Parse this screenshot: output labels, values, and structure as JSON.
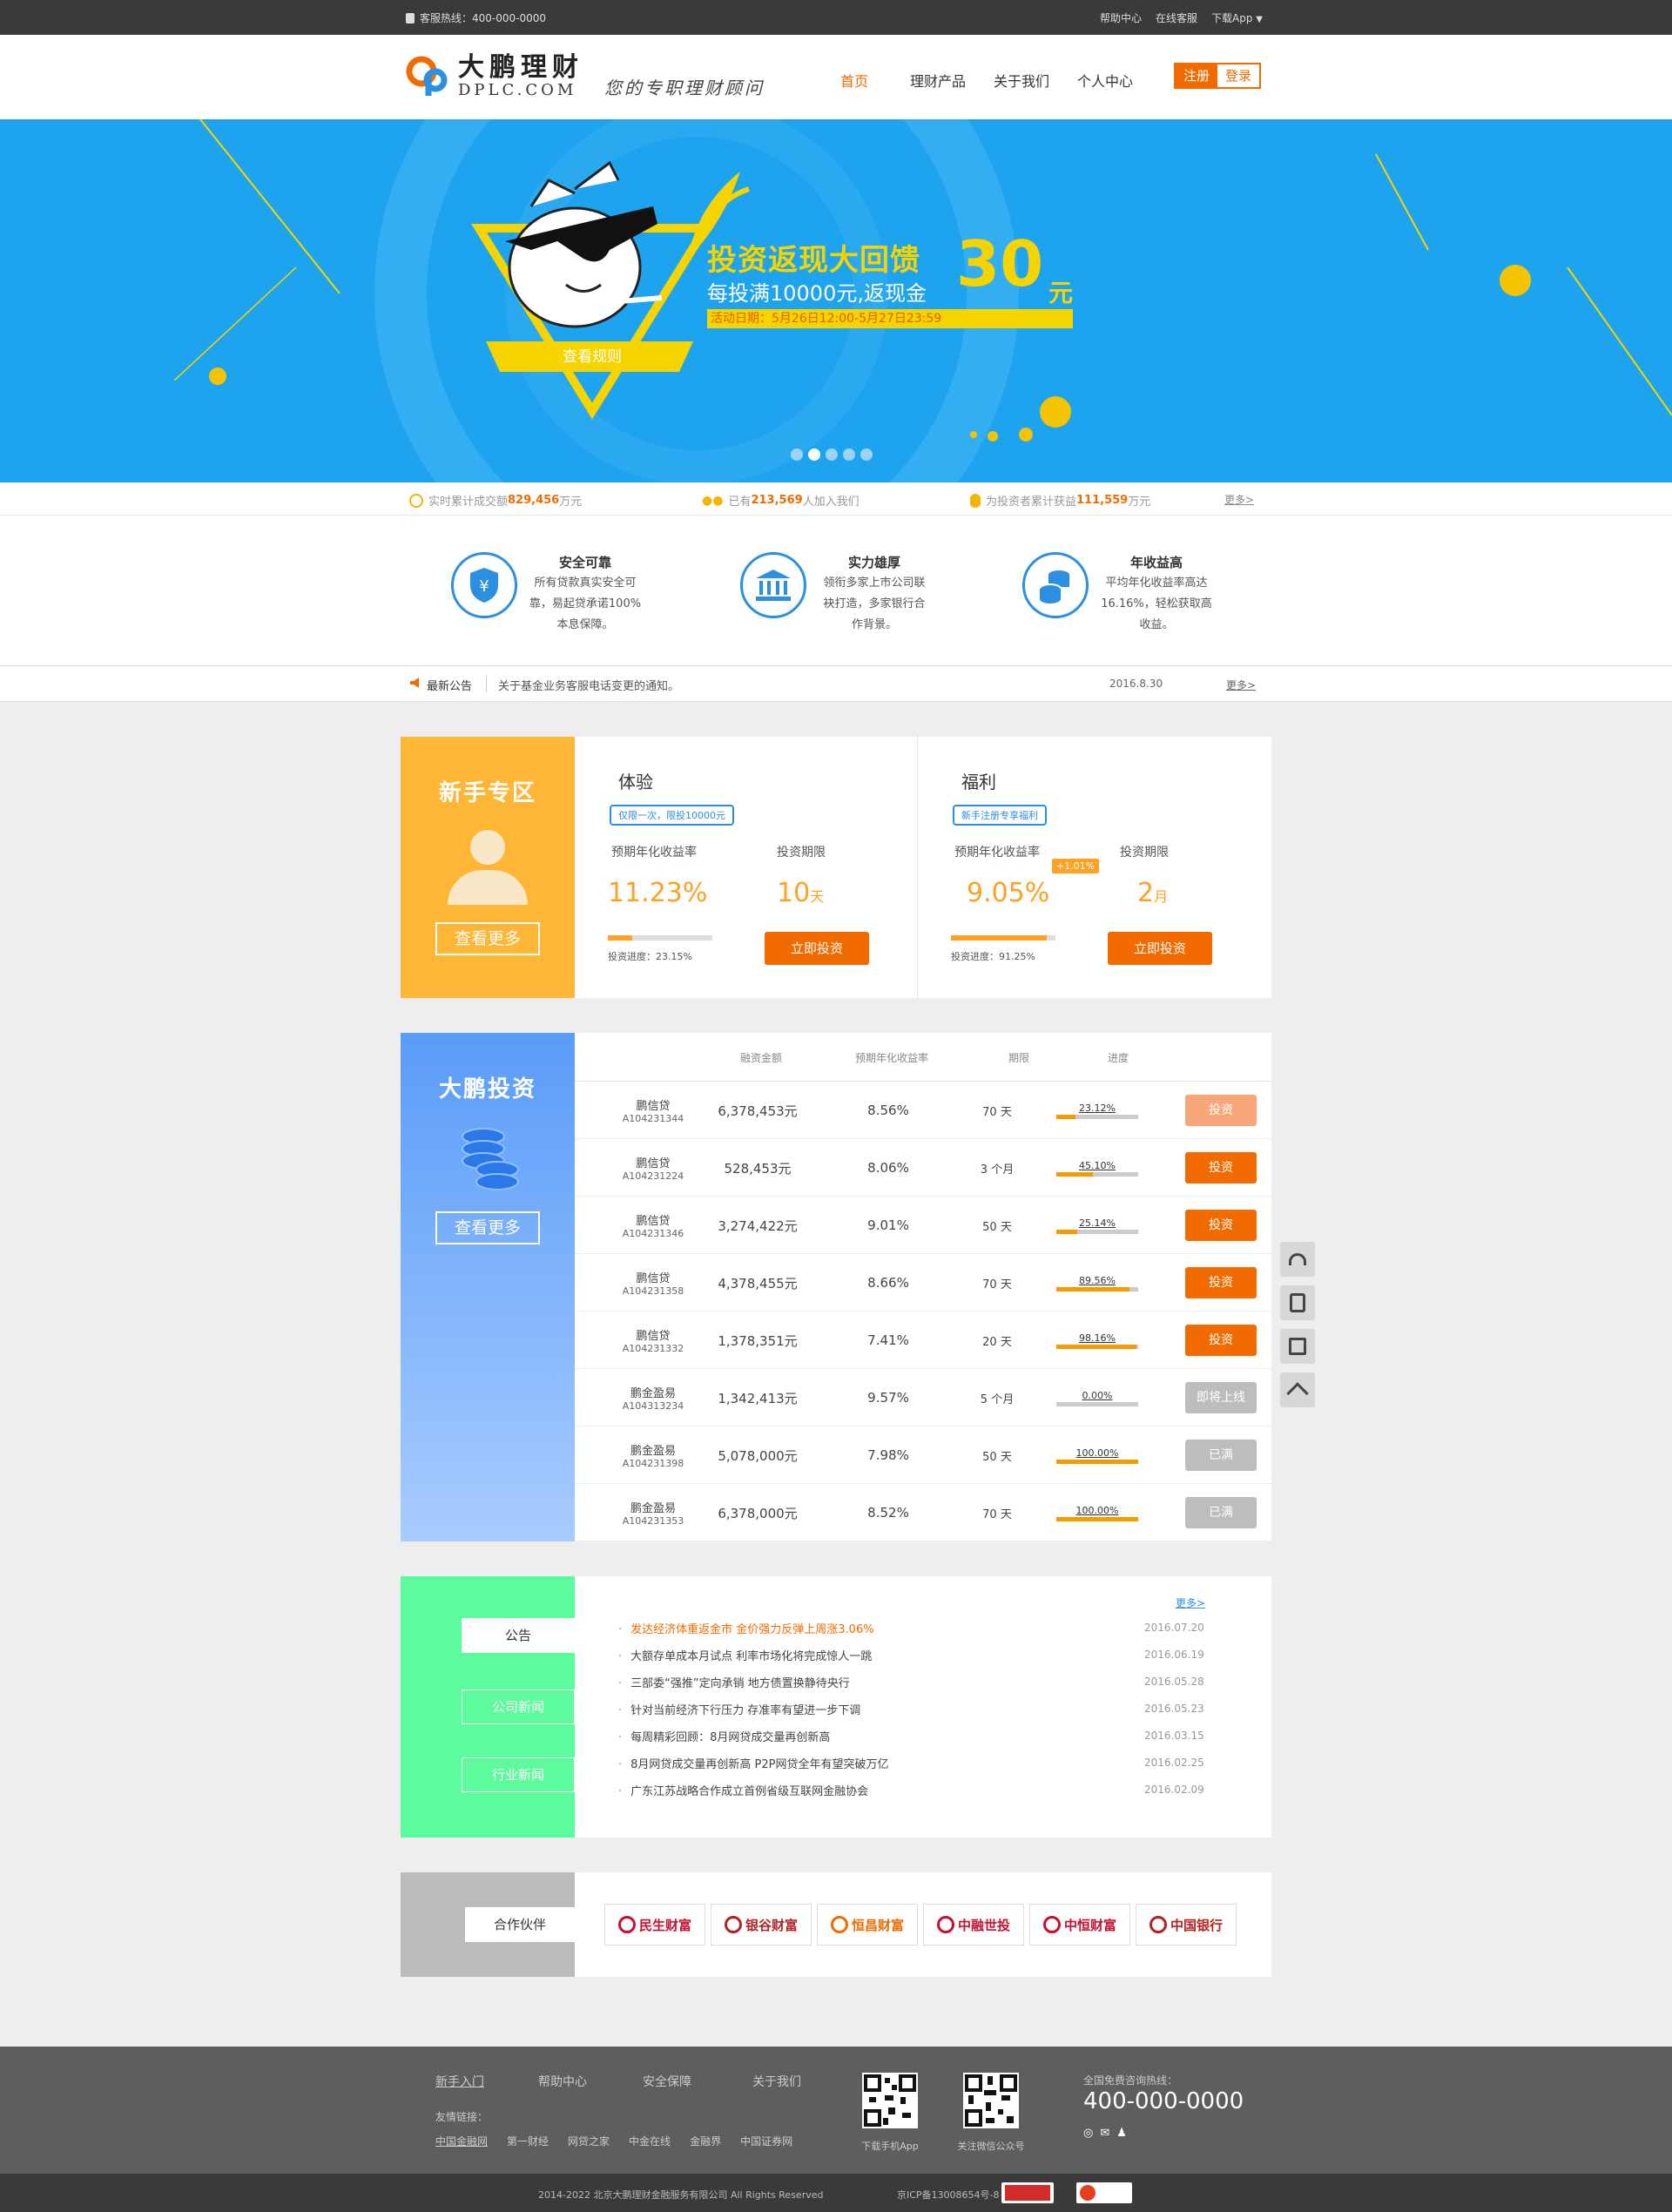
{
  "topbar": {
    "hotline": "客服热线：400-000-0000",
    "links": [
      "帮助中心",
      "在线客服",
      "下载App"
    ]
  },
  "logo": {
    "name": "大鹏理财",
    "domain": "DPLC.COM",
    "slogan": "您的专职理财顾问"
  },
  "nav": {
    "items": [
      "首页",
      "理财产品",
      "关于我们",
      "个人中心"
    ],
    "register": "注册",
    "login": "登录"
  },
  "banner": {
    "headline": "投资返现大回馈",
    "line2": "每投满10000元,返现金",
    "amount": "30",
    "unit": "元",
    "date": "活动日期：5月26日12:00-5月27日23:59",
    "rules_btn": "查看规则"
  },
  "stats": {
    "s1_pre": "实时累计成交额",
    "s1_val": "829,456",
    "s1_unit": "万元",
    "s2_pre": "已有",
    "s2_val": "213,569",
    "s2_unit": "人加入我们",
    "s3_pre": "为投资者累计获益",
    "s3_val": "111,559",
    "s3_unit": "万元",
    "more": "更多>"
  },
  "features": [
    {
      "title": "安全可靠",
      "l1": "所有贷款真实安全可",
      "l2": "靠，易起贷承诺100%",
      "l3": "本息保障。"
    },
    {
      "title": "实力雄厚",
      "l1": "领衔多家上市公司联",
      "l2": "袂打造，多家银行合",
      "l3": "作背景。"
    },
    {
      "title": "年收益高",
      "l1": "平均年化收益率高达",
      "l2": "16.16%，轻松获取高",
      "l3": "收益。"
    }
  ],
  "notice": {
    "label": "最新公告",
    "text": "关于基金业务客服电话变更的通知。",
    "date": "2016.8.30",
    "more": "更多>"
  },
  "newbie": {
    "title": "新手专区",
    "more": "查看更多",
    "products": [
      {
        "name": "体验",
        "tag": "仅限一次，限投10000元",
        "rate_label": "预期年化收益率",
        "term_label": "投资期限",
        "rate": "11.23%",
        "term": "10",
        "term_unit": "天",
        "progress_text": "投资进度：23.15%",
        "progress": 23.15,
        "btn": "立即投资",
        "bonus": ""
      },
      {
        "name": "福利",
        "tag": "新手注册专享福利",
        "rate_label": "预期年化收益率",
        "term_label": "投资期限",
        "rate": "9.05%",
        "term": "2",
        "term_unit": "月",
        "progress_text": "投资进度：91.25%",
        "progress": 91.25,
        "btn": "立即投资",
        "bonus": "+1.01%"
      }
    ]
  },
  "invest": {
    "title": "大鹏投资",
    "more": "查看更多",
    "headers": [
      "融资金额",
      "预期年化收益率",
      "期限",
      "进度"
    ],
    "rows": [
      {
        "name": "鹏信贷",
        "code": "A104231344",
        "amount": "6,378,453元",
        "rate": "8.56%",
        "term": "70 天",
        "progress": 23.12,
        "progress_text": "23.12%",
        "action": "投资",
        "state": "light"
      },
      {
        "name": "鹏信贷",
        "code": "A104231224",
        "amount": "528,453元",
        "rate": "8.06%",
        "term": "3 个月",
        "progress": 45.1,
        "progress_text": "45.10%",
        "action": "投资",
        "state": "active"
      },
      {
        "name": "鹏信贷",
        "code": "A104231346",
        "amount": "3,274,422元",
        "rate": "9.01%",
        "term": "50 天",
        "progress": 25.14,
        "progress_text": "25.14%",
        "action": "投资",
        "state": "active"
      },
      {
        "name": "鹏信贷",
        "code": "A104231358",
        "amount": "4,378,455元",
        "rate": "8.66%",
        "term": "70 天",
        "progress": 89.56,
        "progress_text": "89.56%",
        "action": "投资",
        "state": "active"
      },
      {
        "name": "鹏信贷",
        "code": "A104231332",
        "amount": "1,378,351元",
        "rate": "7.41%",
        "term": "20 天",
        "progress": 98.16,
        "progress_text": "98.16%",
        "action": "投资",
        "state": "active"
      },
      {
        "name": "鹏金盈易",
        "code": "A104313234",
        "amount": "1,342,413元",
        "rate": "9.57%",
        "term": "5 个月",
        "progress": 0,
        "progress_text": "0.00%",
        "action": "即将上线",
        "state": "disabled"
      },
      {
        "name": "鹏金盈易",
        "code": "A104231398",
        "amount": "5,078,000元",
        "rate": "7.98%",
        "term": "50 天",
        "progress": 100,
        "progress_text": "100.00%",
        "action": "已满",
        "state": "disabled"
      },
      {
        "name": "鹏金盈易",
        "code": "A104231353",
        "amount": "6,378,000元",
        "rate": "8.52%",
        "term": "70 天",
        "progress": 100,
        "progress_text": "100.00%",
        "action": "已满",
        "state": "disabled"
      }
    ]
  },
  "news": {
    "tabs": [
      "公告",
      "公司新闻",
      "行业新闻"
    ],
    "more": "更多>",
    "items": [
      {
        "title": "发达经济体重返金市 金价强力反弹上周涨3.06%",
        "date": "2016.07.20",
        "hot": true
      },
      {
        "title": "大额存单成本月试点 利率市场化将完成惊人一跳",
        "date": "2016.06.19",
        "hot": false
      },
      {
        "title": "三部委“强推”定向承销 地方债置换静待央行",
        "date": "2016.05.28",
        "hot": false
      },
      {
        "title": "针对当前经济下行压力 存准率有望进一步下调",
        "date": "2016.05.23",
        "hot": false
      },
      {
        "title": "每周精彩回顾：8月网贷成交量再创新高",
        "date": "2016.03.15",
        "hot": false
      },
      {
        "title": "8月网贷成交量再创新高 P2P网贷全年有望突破万亿",
        "date": "2016.02.25",
        "hot": false
      },
      {
        "title": "广东江苏战略合作成立首例省级互联网金融协会",
        "date": "2016.02.09",
        "hot": false
      }
    ]
  },
  "partners": {
    "title": "合作伙伴",
    "items": [
      {
        "name": "民生财富",
        "color": "#c8102e"
      },
      {
        "name": "银谷财富",
        "color": "#b22222"
      },
      {
        "name": "恒昌财富",
        "color": "#f26b00"
      },
      {
        "name": "中融世投",
        "color": "#c8102e"
      },
      {
        "name": "中恒财富",
        "color": "#c8102e"
      },
      {
        "name": "中国银行",
        "color": "#b22222"
      }
    ]
  },
  "footer": {
    "links": [
      "新手入门",
      "帮助中心",
      "安全保障",
      "关于我们"
    ],
    "friend_label": "友情链接：",
    "friends": [
      "中国金融网",
      "第一财经",
      "网贷之家",
      "中金在线",
      "金融界",
      "中国证券网"
    ],
    "qr1": "下载手机App",
    "qr2": "关注微信公众号",
    "hotline_label": "全国免费咨询热线：",
    "hotline": "400-000-0000",
    "copyright": "2014-2022 北京大鹏理财金融服务有限公司 All Rights Reserved",
    "icp": "京ICP备13008654号-8"
  },
  "colors": {
    "orange": "#f26b00",
    "banner_blue": "#1ea4ee",
    "newbie_yellow": "#ffb535",
    "invest_blue": "#5a9cf8",
    "news_green": "#5efb9c",
    "partner_gray": "#bbbbbb"
  }
}
